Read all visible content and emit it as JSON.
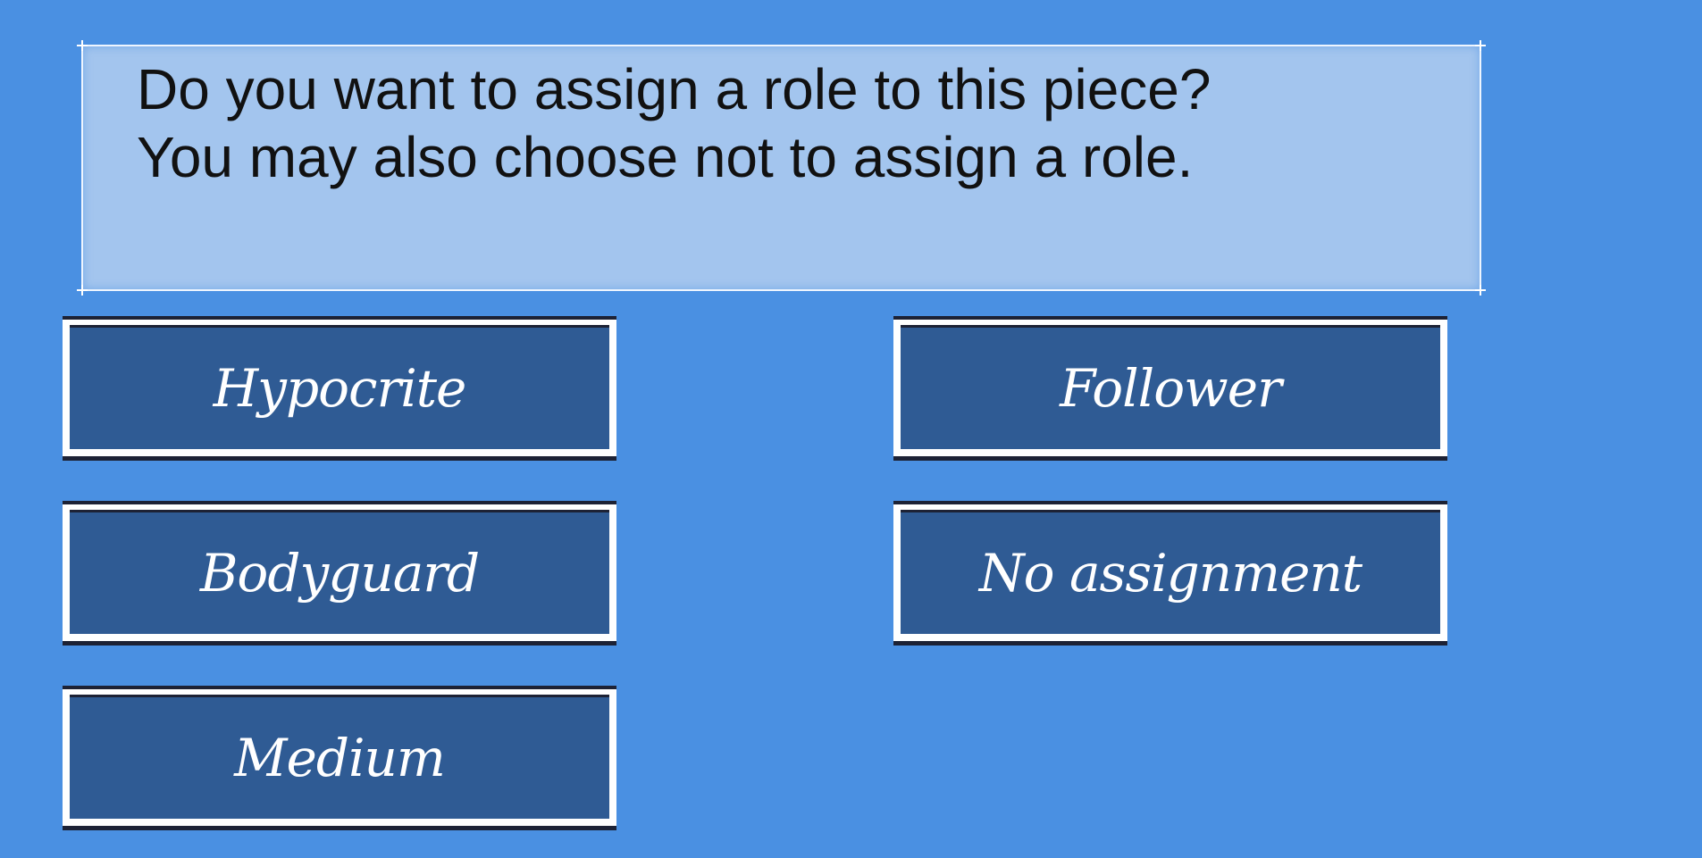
{
  "prompt": {
    "line1": "Do you want to assign a role to this piece?",
    "line2": "You may also choose not to assign a role."
  },
  "roles": {
    "hypocrite": "Hypocrite",
    "bodyguard": "Bodyguard",
    "medium": "Medium",
    "follower": "Follower",
    "no_assignment": "No assignment"
  },
  "colors": {
    "background": "#4a90e2",
    "prompt_box": "#a3c5ee",
    "button_fill": "#2f5b94",
    "button_border": "#ffffff",
    "button_text": "#ffffff"
  }
}
